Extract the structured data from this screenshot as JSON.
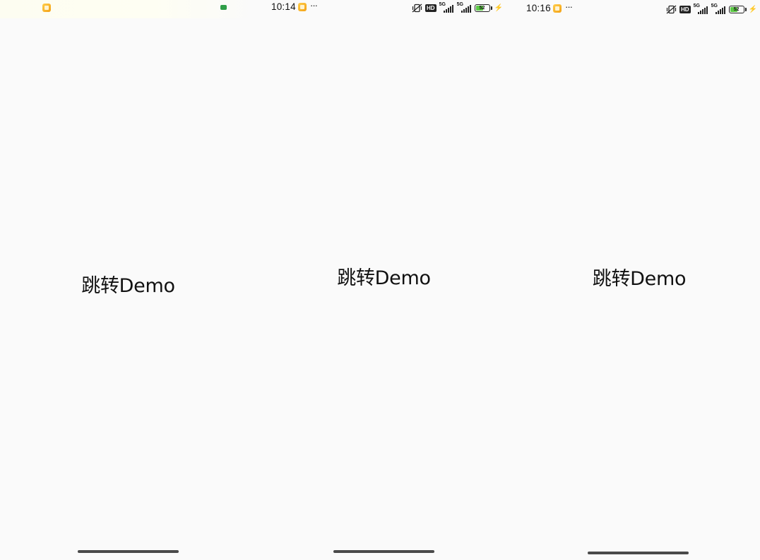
{
  "frames": [
    {
      "id": "frame-1",
      "statusbar": {
        "time": "",
        "show_icons": false
      },
      "title": "跳转Demo"
    },
    {
      "id": "frame-2",
      "statusbar": {
        "time": "10:14",
        "more": "···",
        "network_badge": "HD",
        "signal_1_label": "5G",
        "signal_2_label": "5G",
        "battery_level": "52",
        "battery_percent": 52,
        "charging": true
      },
      "title": "跳转Demo"
    },
    {
      "id": "frame-3",
      "statusbar": {
        "time": "10:16",
        "more": "···",
        "network_badge": "HD",
        "signal_1_label": "5G",
        "signal_2_label": "5G",
        "battery_level": "52",
        "battery_percent": 52,
        "charging": true
      },
      "title": "跳转Demo"
    }
  ],
  "icons": {
    "app_notification": "notes-app-icon",
    "green_indicator": "green-status-icon",
    "mute": "vibrate-off-icon",
    "charging": "lightning-icon"
  },
  "colors": {
    "background": "#fafafa",
    "text": "#111111",
    "app_icon": "#f3a116",
    "battery_fill": "#5cc945",
    "home_indicator": "#4a4a4a"
  }
}
